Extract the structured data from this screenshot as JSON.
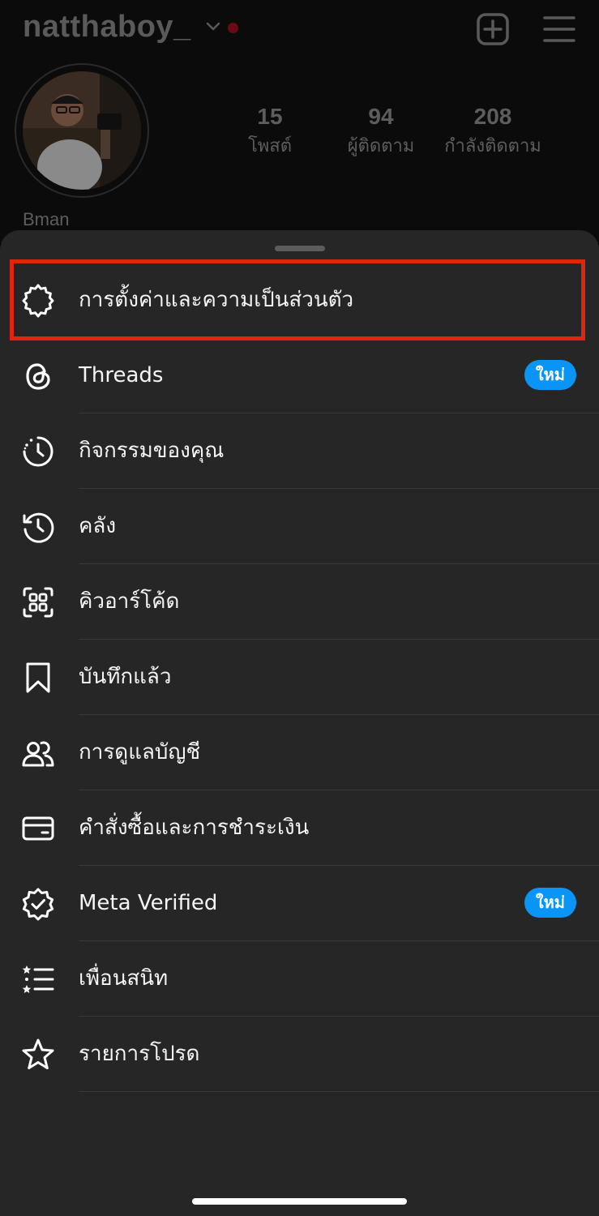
{
  "profile": {
    "username": "natthaboy_",
    "full_name": "Bman",
    "stats": [
      {
        "value": "15",
        "label": "โพสต์"
      },
      {
        "value": "94",
        "label": "ผู้ติดตาม"
      },
      {
        "value": "208",
        "label": "กำลังติดตาม"
      }
    ]
  },
  "colors": {
    "accent_blue": "#0a95f6",
    "highlight_red": "#e0250f",
    "sheet_bg": "#262626"
  },
  "menu": {
    "items": [
      {
        "label": "การตั้งค่าและความเป็นส่วนตัว",
        "icon": "gear-icon"
      },
      {
        "label": "Threads",
        "icon": "threads-icon",
        "badge": "ใหม่"
      },
      {
        "label": "กิจกรรมของคุณ",
        "icon": "activity-icon"
      },
      {
        "label": "คลัง",
        "icon": "archive-icon"
      },
      {
        "label": "คิวอาร์โค้ด",
        "icon": "qr-code-icon"
      },
      {
        "label": "บันทึกแล้ว",
        "icon": "bookmark-icon"
      },
      {
        "label": "การดูแลบัญชี",
        "icon": "supervision-icon"
      },
      {
        "label": "คำสั่งซื้อและการชำระเงิน",
        "icon": "card-icon"
      },
      {
        "label": "Meta Verified",
        "icon": "verified-badge-icon",
        "badge": "ใหม่"
      },
      {
        "label": "เพื่อนสนิท",
        "icon": "close-friends-icon"
      },
      {
        "label": "รายการโปรด",
        "icon": "star-icon"
      }
    ]
  }
}
